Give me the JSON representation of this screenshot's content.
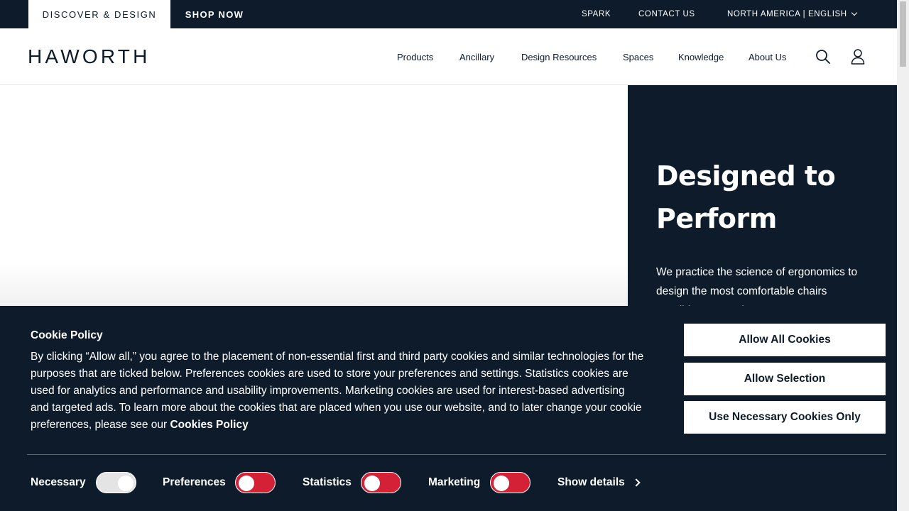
{
  "topbar": {
    "discover_label": "DISCOVER & DESIGN",
    "shop_label": "SHOP NOW",
    "spark_label": "SPARK",
    "contact_label": "CONTACT US",
    "region_label": "NORTH AMERICA | ENGLISH"
  },
  "header": {
    "logo_text": "HAWORTH",
    "nav": [
      "Products",
      "Ancillary",
      "Design Resources",
      "Spaces",
      "Knowledge",
      "About Us"
    ],
    "icons": [
      "search-icon",
      "user-icon"
    ]
  },
  "hero": {
    "title_line1": "Designed to",
    "title_line2": "Perform",
    "body": "We practice the science of ergonomics to design the most comfortable chairs possible. Zen Tech"
  },
  "cookie": {
    "title": "Cookie Policy",
    "text": "By clicking “Allow all,” you agree to the placement of non-essential first and third party cookies and similar technologies for the purposes that are ticked below. Preferences cookies are used to store your preferences and settings. Statistics cookies are used for analytics and performance and usability improvements. Marketing cookies are used for interest-based advertising and targeted ads. To learn more about the cookies that are placed when you use our website, and to later change your cookie preferences, please see our ",
    "link_text": "Cookies Policy",
    "buttons": {
      "allow_all": "Allow All Cookies",
      "allow_selection": "Allow Selection",
      "necessary_only": "Use Necessary Cookies Only"
    },
    "options": {
      "necessary": "Necessary",
      "preferences": "Preferences",
      "statistics": "Statistics",
      "marketing": "Marketing"
    },
    "show_details": "Show details",
    "colors": {
      "background": "#0d1b2a",
      "toggle_off": "#d42136",
      "toggle_on": "#e4e4e4"
    }
  }
}
